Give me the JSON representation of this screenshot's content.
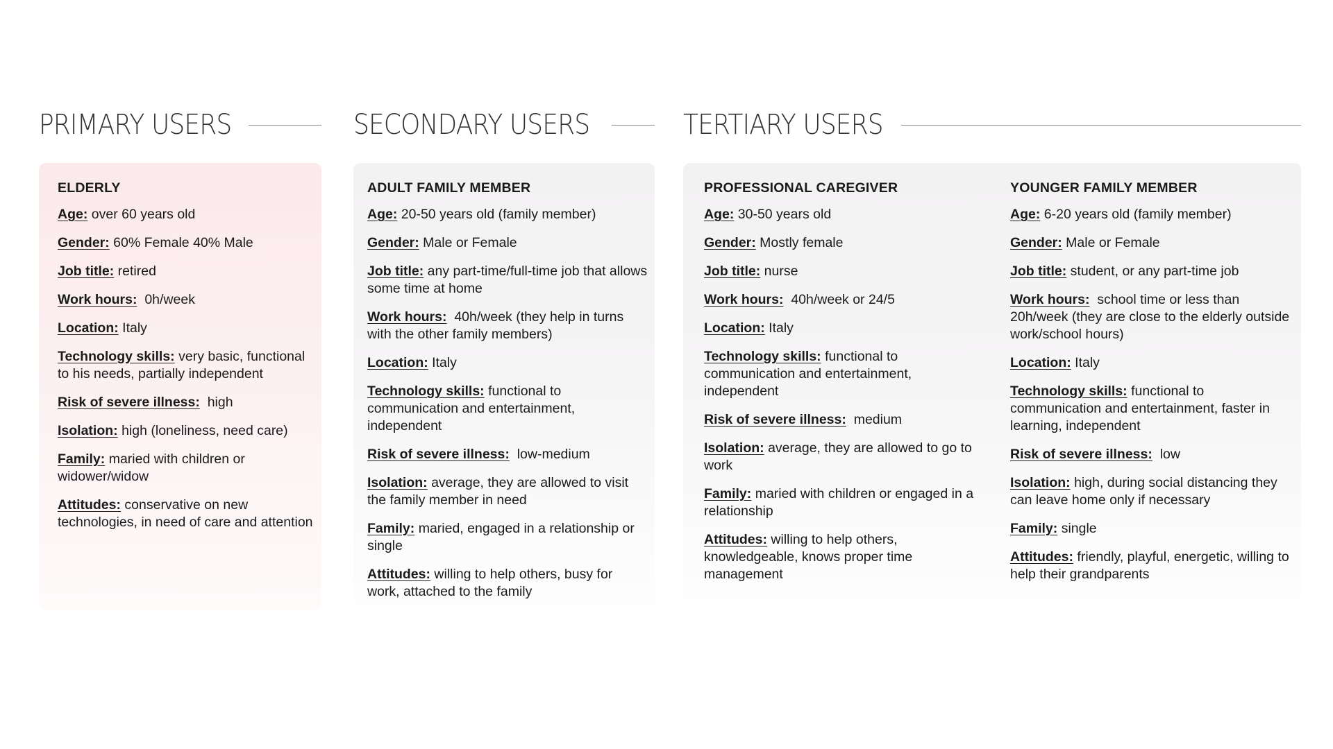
{
  "primary": {
    "title": "PRIMARY USERS",
    "persona": {
      "name": "ELDERLY",
      "fields": [
        {
          "label": "Age:",
          "value": " over 60 years old"
        },
        {
          "label": "Gender:",
          "value": " 60% Female 40% Male"
        },
        {
          "label": "Job title:",
          "value": " retired"
        },
        {
          "label": "Work hours:",
          "value": "  0h/week"
        },
        {
          "label": "Location:",
          "value": " Italy"
        },
        {
          "label": "Technology skills:",
          "value": " very basic, functional to his needs, partially independent"
        },
        {
          "label": "Risk of severe illness:",
          "value": "  high"
        },
        {
          "label": "Isolation:",
          "value": " high (loneliness, need care)"
        },
        {
          "label": "Family:",
          "value": " maried with children or widower/widow"
        },
        {
          "label": "Attitudes:",
          "value": " conservative on new technologies, in need of care and attention"
        }
      ]
    }
  },
  "secondary": {
    "title": "SECONDARY USERS",
    "persona": {
      "name": "ADULT FAMILY MEMBER",
      "fields": [
        {
          "label": "Age:",
          "value": " 20-50 years old (family member)"
        },
        {
          "label": "Gender:",
          "value": " Male or Female"
        },
        {
          "label": "Job title:",
          "value": " any part-time/full-time job that allows some time at home"
        },
        {
          "label": "Work hours:",
          "value": "  40h/week (they help in turns with the other family members)"
        },
        {
          "label": "Location:",
          "value": " Italy"
        },
        {
          "label": "Technology skills:",
          "value": " functional to communication and entertainment, independent"
        },
        {
          "label": "Risk of severe illness:",
          "value": "  low-medium"
        },
        {
          "label": "Isolation:",
          "value": " average, they are allowed to visit the family member in need"
        },
        {
          "label": "Family:",
          "value": " maried, engaged in a relationship or single"
        },
        {
          "label": "Attitudes:",
          "value": " willing to help others, busy for work, attached to the family"
        }
      ]
    }
  },
  "tertiary": {
    "title": "TERTIARY USERS",
    "personas": [
      {
        "name": "PROFESSIONAL CAREGIVER",
        "fields": [
          {
            "label": "Age:",
            "value": " 30-50 years old"
          },
          {
            "label": "Gender:",
            "value": " Mostly female"
          },
          {
            "label": "Job title:",
            "value": " nurse"
          },
          {
            "label": "Work hours:",
            "value": "  40h/week or 24/5"
          },
          {
            "label": "Location:",
            "value": " Italy"
          },
          {
            "label": "Technology skills:",
            "value": " functional to communication and entertainment, independent"
          },
          {
            "label": "Risk of severe illness:",
            "value": "  medium"
          },
          {
            "label": "Isolation:",
            "value": " average, they are allowed to go to work"
          },
          {
            "label": "Family:",
            "value": " maried with children or engaged in a relationship"
          },
          {
            "label": "Attitudes:",
            "value": " willing to help others, knowledgeable, knows proper time management"
          }
        ]
      },
      {
        "name": "YOUNGER FAMILY MEMBER",
        "fields": [
          {
            "label": "Age:",
            "value": " 6-20 years old (family member)"
          },
          {
            "label": "Gender:",
            "value": " Male or Female"
          },
          {
            "label": "Job title:",
            "value": " student, or any part-time job"
          },
          {
            "label": "Work hours:",
            "value": "  school time or less than 20h/week (they are close to the elderly outside work/school hours)"
          },
          {
            "label": "Location:",
            "value": " Italy"
          },
          {
            "label": "Technology skills:",
            "value": " functional to communication and entertainment, faster in learning, independent"
          },
          {
            "label": "Risk of severe illness:",
            "value": "  low"
          },
          {
            "label": "Isolation:",
            "value": " high, during social distancing they can leave home only if necessary"
          },
          {
            "label": "Family:",
            "value": " single"
          },
          {
            "label": "Attitudes:",
            "value": " friendly, playful, energetic, willing to help their grandparents"
          }
        ]
      }
    ]
  },
  "colors": {
    "primary_card": "#fbe9eb",
    "other_cards": "#f3f2f3",
    "text": "#1a1a1a",
    "rule": "#8a8a8a"
  }
}
